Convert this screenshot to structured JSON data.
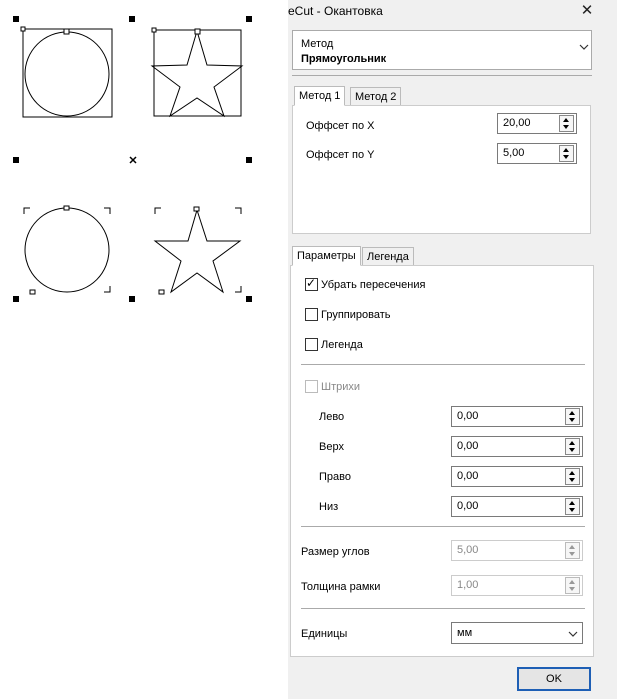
{
  "window": {
    "title": "eCut - Окантовка",
    "close_glyph": "✕"
  },
  "method": {
    "label": "Метод",
    "value": "Прямоугольник"
  },
  "method_tabs": [
    "Метод 1",
    "Метод 2"
  ],
  "offset": {
    "x_label": "Оффсет по X",
    "x_value": "20,00",
    "y_label": "Оффсет по Y",
    "y_value": "5,00"
  },
  "param_tabs": [
    "Параметры",
    "Легенда"
  ],
  "params": {
    "remove_intersections": {
      "label": "Убрать пересечения",
      "checked": true
    },
    "group": {
      "label": "Группировать",
      "checked": false
    },
    "legend": {
      "label": "Легенда",
      "checked": false
    },
    "strokes": {
      "label": "Штрихи",
      "checked": false,
      "enabled": false
    },
    "left": {
      "label": "Лево",
      "value": "0,00"
    },
    "top": {
      "label": "Верх",
      "value": "0,00"
    },
    "right": {
      "label": "Право",
      "value": "0,00"
    },
    "bottom": {
      "label": "Низ",
      "value": "0,00"
    },
    "corner_size": {
      "label": "Размер углов",
      "value": "5,00"
    },
    "frame_thickness": {
      "label": "Толщина рамки",
      "value": "1,00"
    },
    "units": {
      "label": "Единицы",
      "value": "мм"
    }
  },
  "ok_label": "OK",
  "icons": {
    "dropdown": "chevron-down-icon",
    "checkmark": "check-icon"
  }
}
